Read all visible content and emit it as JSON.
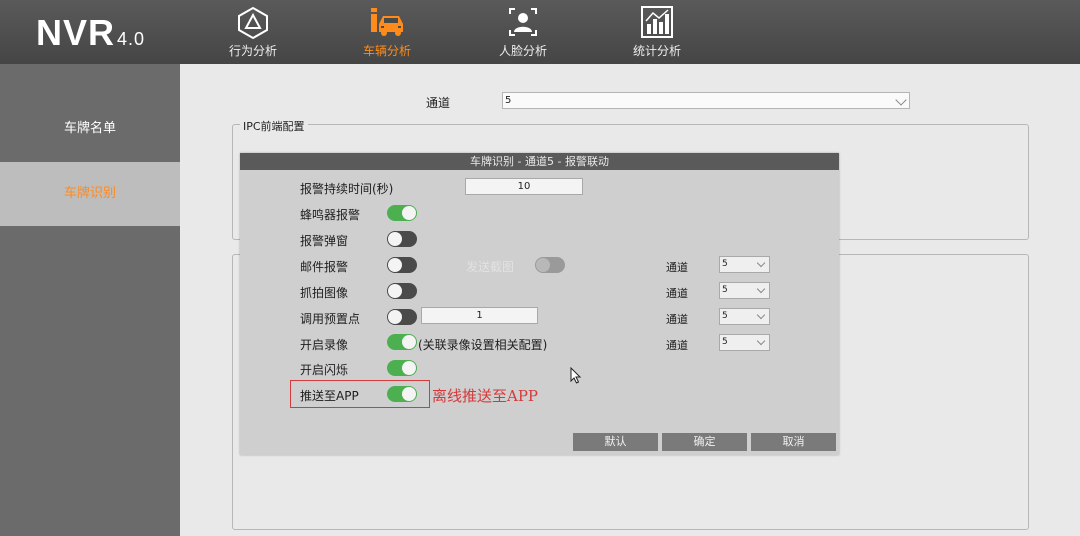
{
  "header": {
    "logo": "NVR",
    "logo_version": "4.0",
    "nav": [
      {
        "label": "行为分析",
        "icon": "behavior-analysis-icon"
      },
      {
        "label": "车辆分析",
        "icon": "vehicle-analysis-icon",
        "active": true
      },
      {
        "label": "人脸分析",
        "icon": "face-analysis-icon"
      },
      {
        "label": "统计分析",
        "icon": "statistics-icon"
      }
    ]
  },
  "sidebar": {
    "items": [
      {
        "label": "车牌名单"
      },
      {
        "label": "车牌识别",
        "active": true
      }
    ]
  },
  "main": {
    "channel_label": "通道",
    "channel_value": "5",
    "section_title": "IPC前端配置"
  },
  "dialog": {
    "title": "车牌识别 - 通道5 - 报警联动",
    "alarm_duration_label": "报警持续时间(秒)",
    "alarm_duration_value": "10",
    "buzzer_label": "蜂鸣器报警",
    "popup_label": "报警弹窗",
    "email_label": "邮件报警",
    "attach_image_label": "发送截图",
    "snapshot_label": "抓拍图像",
    "preset_label": "调用预置点",
    "preset_value": "1",
    "record_label": "开启录像",
    "record_note": "(关联录像设置相关配置)",
    "flash_label": "开启闪烁",
    "push_app_label": "推送至APP",
    "channel_label": "通道",
    "email_channel": "5",
    "snapshot_channel": "5",
    "preset_channel": "5",
    "record_channel": "5",
    "buttons": {
      "default": "默认",
      "ok": "确定",
      "cancel": "取消"
    }
  },
  "annotation": {
    "text": "离线推送至APP",
    "color": "#d43a3a"
  },
  "colors": {
    "accent": "#ff8a1e",
    "toggle_on": "#4caf50",
    "toggle_off": "#4a4a4a"
  }
}
